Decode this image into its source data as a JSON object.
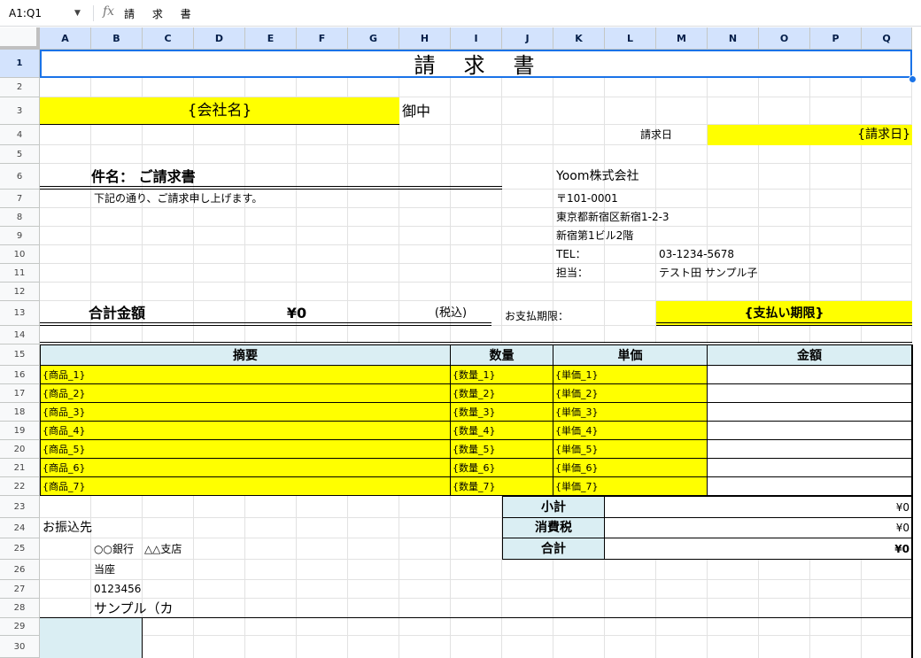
{
  "toolbar": {
    "namebox": "A1:Q1",
    "formula": "請 求 書"
  },
  "columns": [
    "A",
    "B",
    "C",
    "D",
    "E",
    "F",
    "G",
    "H",
    "I",
    "J",
    "K",
    "L",
    "M",
    "N",
    "O",
    "P",
    "Q"
  ],
  "rows": [
    "1",
    "2",
    "3",
    "4",
    "5",
    "6",
    "7",
    "8",
    "9",
    "10",
    "11",
    "12",
    "13",
    "14",
    "15",
    "16",
    "17",
    "18",
    "19",
    "20",
    "21",
    "22",
    "23",
    "24",
    "25",
    "26",
    "27",
    "28",
    "29",
    "30"
  ],
  "invoice": {
    "title": "請　求　書",
    "company_placeholder": "{会社名}",
    "honorific": "御中",
    "date_label": "請求日",
    "date_placeholder": "{請求日}",
    "subject": "件名：  ご請求書",
    "intro": "下記の通り、ご請求申し上げます。",
    "sender": {
      "name": "Yoom株式会社",
      "zip": "〒101-0001",
      "address1": "東京都新宿区新宿1-2-3",
      "address2": "新宿第1ビル2階",
      "tel_label": "TEL：",
      "tel": "03-1234-5678",
      "person_label": "担当：",
      "person": "テスト田 サンプル子"
    },
    "total_label": "合計金額",
    "total_value": "¥0",
    "tax_note": "(税込)",
    "due_label": "お支払期限：",
    "due_placeholder": "{支払い期限}",
    "table_headers": {
      "desc": "摘要",
      "qty": "数量",
      "unit": "単価",
      "amount": "金額"
    },
    "items": [
      {
        "desc": "{商品_1}",
        "qty": "{数量_1}",
        "unit": "{単価_1}"
      },
      {
        "desc": "{商品_2}",
        "qty": "{数量_2}",
        "unit": "{単価_2}"
      },
      {
        "desc": "{商品_3}",
        "qty": "{数量_3}",
        "unit": "{単価_3}"
      },
      {
        "desc": "{商品_4}",
        "qty": "{数量_4}",
        "unit": "{単価_4}"
      },
      {
        "desc": "{商品_5}",
        "qty": "{数量_5}",
        "unit": "{単価_5}"
      },
      {
        "desc": "{商品_6}",
        "qty": "{数量_6}",
        "unit": "{単価_6}"
      },
      {
        "desc": "{商品_7}",
        "qty": "{数量_7}",
        "unit": "{単価_7}"
      }
    ],
    "subtotal_label": "小計",
    "subtotal_value": "¥0",
    "tax_label": "消費税",
    "tax_value": "¥0",
    "grand_label": "合計",
    "grand_value": "¥0",
    "bank_label": "お振込先",
    "bank_name": "○○銀行　△△支店",
    "account_type": "当座",
    "account_no": "0123456",
    "account_holder": "サンプル（カ"
  },
  "colors": {
    "highlight": "#ffff00",
    "header_fill": "#daeef3",
    "selection": "#1a73e8"
  }
}
